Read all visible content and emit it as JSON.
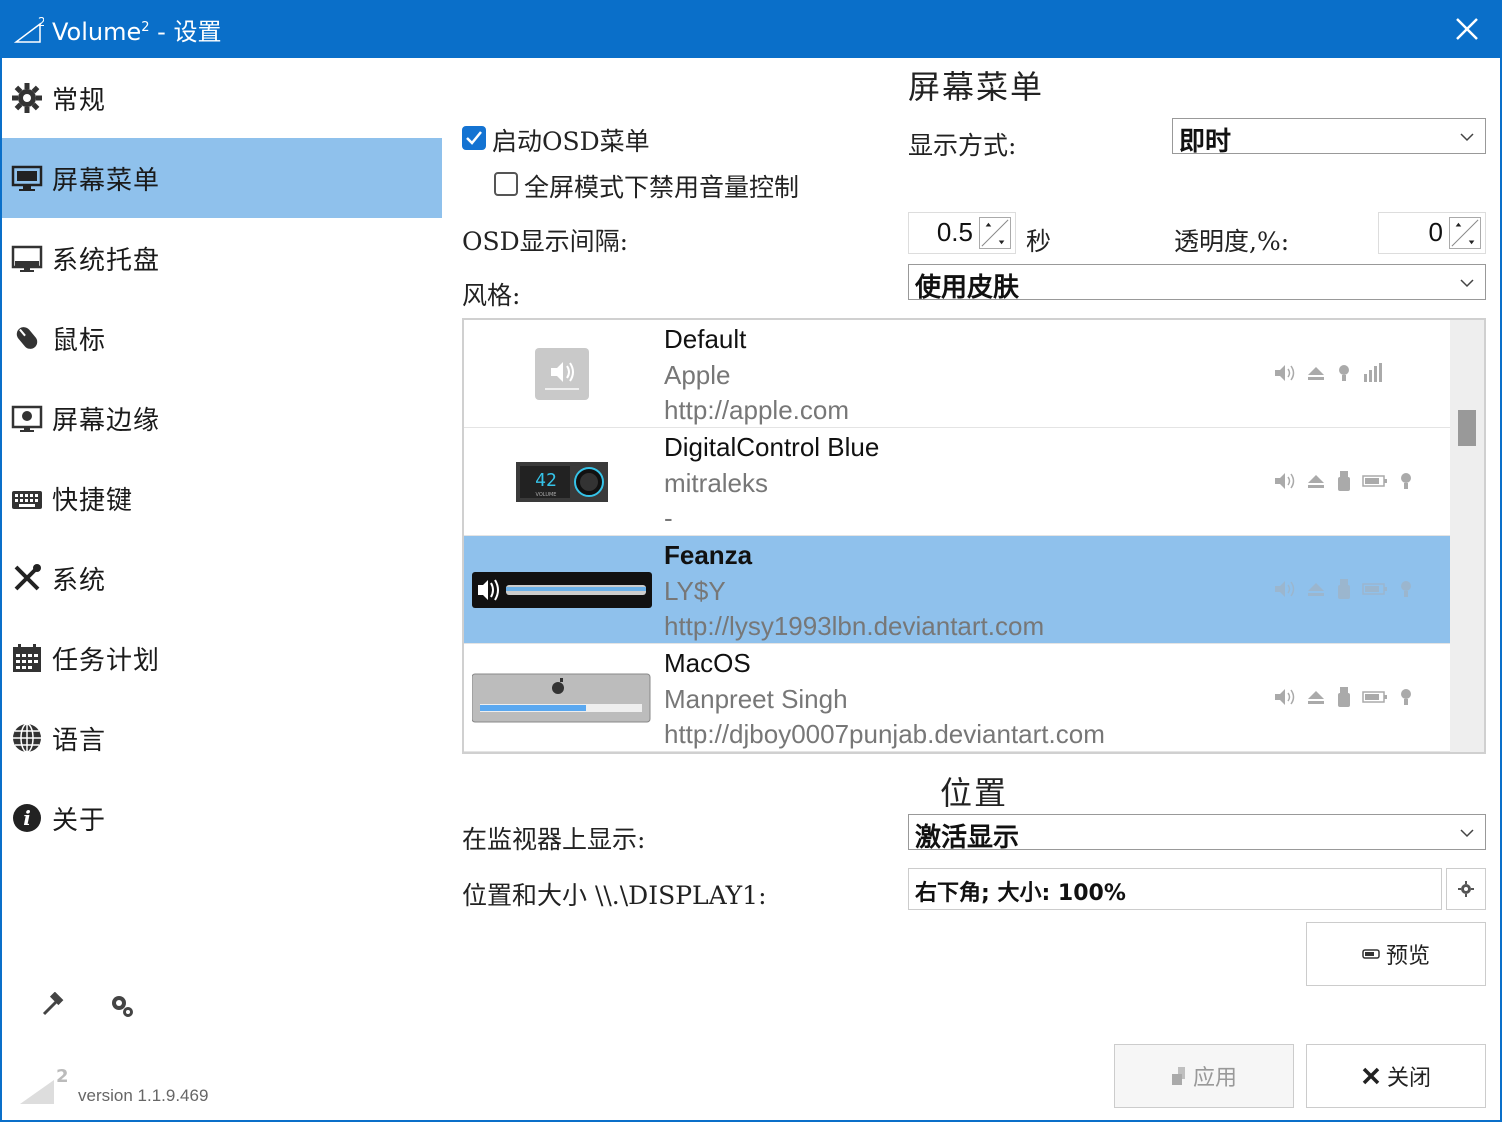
{
  "window": {
    "title_main": "Volume",
    "title_sup": "2",
    "title_suffix": " - 设置",
    "accent": "#0a6fc9"
  },
  "sidebar": {
    "items": [
      {
        "label": "常规",
        "icon": "gear-icon"
      },
      {
        "label": "屏幕菜单",
        "icon": "monitor-icon",
        "active": true
      },
      {
        "label": "系统托盘",
        "icon": "tray-icon"
      },
      {
        "label": "鼠标",
        "icon": "mouse-icon"
      },
      {
        "label": "屏幕边缘",
        "icon": "screen-edge-icon"
      },
      {
        "label": "快捷键",
        "icon": "keyboard-icon"
      },
      {
        "label": "系统",
        "icon": "tools-icon"
      },
      {
        "label": "任务计划",
        "icon": "calendar-icon"
      },
      {
        "label": "语言",
        "icon": "globe-icon"
      },
      {
        "label": "关于",
        "icon": "info-icon"
      }
    ],
    "active_color": "#8fc1ec"
  },
  "footer": {
    "logo_sup": "2",
    "version": "version 1.1.9.469"
  },
  "osd": {
    "section_title": "屏幕菜单",
    "enable_label": "启动OSD菜单",
    "enable_checked": true,
    "fullscreen_label": "全屏模式下禁用音量控制",
    "fullscreen_checked": false,
    "display_mode_label": "显示方式:",
    "display_mode_value": "即时",
    "interval_label": "OSD显示间隔:",
    "interval_value": "0.5",
    "interval_unit": "秒",
    "transparency_label": "透明度,%:",
    "transparency_value": "0",
    "style_label": "风格:",
    "style_value": "使用皮肤"
  },
  "skins": [
    {
      "name": "Default",
      "author": "Apple",
      "url": "http://apple.com"
    },
    {
      "name": "DigitalControl Blue",
      "author": "mitraleks",
      "url": "-",
      "thumb_value": "42",
      "thumb_label": "VOLUME"
    },
    {
      "name": "Feanza",
      "author": "LY$Y",
      "url": "http://lysy1993lbn.deviantart.com",
      "selected": true
    },
    {
      "name": "MacOS",
      "author": "Manpreet Singh",
      "url": "http://djboy0007punjab.deviantart.com"
    }
  ],
  "position": {
    "section_title": "位置",
    "monitor_label": "在监视器上显示:",
    "monitor_value": "激活显示",
    "size_label": "位置和大小 \\\\.\\DISPLAY1:",
    "size_value": "右下角; 大小: 100%"
  },
  "buttons": {
    "preview": "预览",
    "apply": "应用",
    "close": "关闭"
  }
}
